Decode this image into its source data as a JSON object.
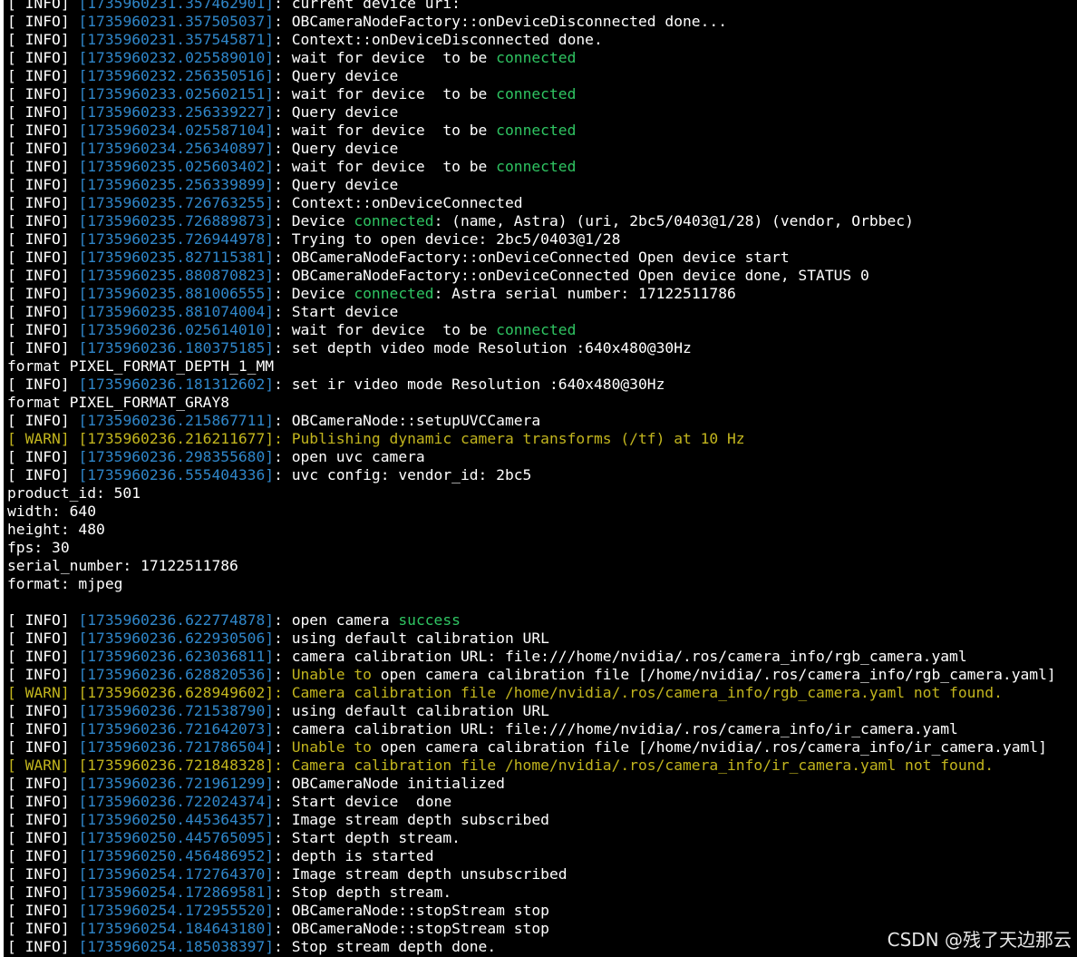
{
  "colors": {
    "background": "#000000",
    "text": "#ffffff",
    "timestamp": "#2f86c9",
    "warn": "#c2b51e",
    "highlight_green": "#2fc462"
  },
  "watermark": "CSDN @残了天边那云",
  "lines": [
    {
      "level": "INFO",
      "ts": "1735960231.357462901",
      "parts": [
        {
          "t": "current device uri:"
        }
      ]
    },
    {
      "level": "INFO",
      "ts": "1735960231.357505037",
      "parts": [
        {
          "t": "OBCameraNodeFactory::onDeviceDisconnected done..."
        }
      ]
    },
    {
      "level": "INFO",
      "ts": "1735960231.357545871",
      "parts": [
        {
          "t": "Context::onDeviceDisconnected done."
        }
      ]
    },
    {
      "level": "INFO",
      "ts": "1735960232.025589010",
      "parts": [
        {
          "t": "wait for device  to be "
        },
        {
          "t": "connected",
          "c": "green"
        }
      ]
    },
    {
      "level": "INFO",
      "ts": "1735960232.256350516",
      "parts": [
        {
          "t": "Query device"
        }
      ]
    },
    {
      "level": "INFO",
      "ts": "1735960233.025602151",
      "parts": [
        {
          "t": "wait for device  to be "
        },
        {
          "t": "connected",
          "c": "green"
        }
      ]
    },
    {
      "level": "INFO",
      "ts": "1735960233.256339227",
      "parts": [
        {
          "t": "Query device"
        }
      ]
    },
    {
      "level": "INFO",
      "ts": "1735960234.025587104",
      "parts": [
        {
          "t": "wait for device  to be "
        },
        {
          "t": "connected",
          "c": "green"
        }
      ]
    },
    {
      "level": "INFO",
      "ts": "1735960234.256340897",
      "parts": [
        {
          "t": "Query device"
        }
      ]
    },
    {
      "level": "INFO",
      "ts": "1735960235.025603402",
      "parts": [
        {
          "t": "wait for device  to be "
        },
        {
          "t": "connected",
          "c": "green"
        }
      ]
    },
    {
      "level": "INFO",
      "ts": "1735960235.256339899",
      "parts": [
        {
          "t": "Query device"
        }
      ]
    },
    {
      "level": "INFO",
      "ts": "1735960235.726763255",
      "parts": [
        {
          "t": "Context::onDeviceConnected"
        }
      ]
    },
    {
      "level": "INFO",
      "ts": "1735960235.726889873",
      "parts": [
        {
          "t": "Device "
        },
        {
          "t": "connected",
          "c": "green"
        },
        {
          "t": ": (name, Astra) (uri, 2bc5/0403@1/28) (vendor, Orbbec)"
        }
      ]
    },
    {
      "level": "INFO",
      "ts": "1735960235.726944978",
      "parts": [
        {
          "t": "Trying to open device: 2bc5/0403@1/28"
        }
      ]
    },
    {
      "level": "INFO",
      "ts": "1735960235.827115381",
      "parts": [
        {
          "t": "OBCameraNodeFactory::onDeviceConnected Open device start"
        }
      ]
    },
    {
      "level": "INFO",
      "ts": "1735960235.880870823",
      "parts": [
        {
          "t": "OBCameraNodeFactory::onDeviceConnected Open device done, STATUS 0"
        }
      ]
    },
    {
      "level": "INFO",
      "ts": "1735960235.881006555",
      "parts": [
        {
          "t": "Device "
        },
        {
          "t": "connected",
          "c": "green"
        },
        {
          "t": ": Astra serial number: 17122511786"
        }
      ]
    },
    {
      "level": "INFO",
      "ts": "1735960235.881074004",
      "parts": [
        {
          "t": "Start device"
        }
      ]
    },
    {
      "level": "INFO",
      "ts": "1735960236.025614010",
      "parts": [
        {
          "t": "wait for device  to be "
        },
        {
          "t": "connected",
          "c": "green"
        }
      ]
    },
    {
      "level": "INFO",
      "ts": "1735960236.180375185",
      "parts": [
        {
          "t": "set depth video mode Resolution :640x480@30Hz"
        }
      ]
    },
    {
      "plain": "format PIXEL_FORMAT_DEPTH_1_MM"
    },
    {
      "level": "INFO",
      "ts": "1735960236.181312602",
      "parts": [
        {
          "t": "set ir video mode Resolution :640x480@30Hz"
        }
      ]
    },
    {
      "plain": "format PIXEL_FORMAT_GRAY8"
    },
    {
      "level": "INFO",
      "ts": "1735960236.215867711",
      "parts": [
        {
          "t": "OBCameraNode::setupUVCCamera"
        }
      ]
    },
    {
      "level": "WARN",
      "ts": "1735960236.216211677",
      "parts": [
        {
          "t": "Publishing dynamic camera transforms (/tf) at 10 Hz",
          "c": "yellow"
        }
      ]
    },
    {
      "level": "INFO",
      "ts": "1735960236.298355680",
      "parts": [
        {
          "t": "open uvc camera"
        }
      ]
    },
    {
      "level": "INFO",
      "ts": "1735960236.555404336",
      "parts": [
        {
          "t": "uvc config: vendor_id: 2bc5"
        }
      ]
    },
    {
      "plain": "product_id: 501"
    },
    {
      "plain": "width: 640"
    },
    {
      "plain": "height: 480"
    },
    {
      "plain": "fps: 30"
    },
    {
      "plain": "serial_number: 17122511786"
    },
    {
      "plain": "format: mjpeg"
    },
    {
      "plain": ""
    },
    {
      "level": "INFO",
      "ts": "1735960236.622774878",
      "parts": [
        {
          "t": "open camera "
        },
        {
          "t": "success",
          "c": "green"
        }
      ]
    },
    {
      "level": "INFO",
      "ts": "1735960236.622930506",
      "parts": [
        {
          "t": "using default calibration URL"
        }
      ]
    },
    {
      "level": "INFO",
      "ts": "1735960236.623036811",
      "parts": [
        {
          "t": "camera calibration URL: file:///home/nvidia/.ros/camera_info/rgb_camera.yaml"
        }
      ]
    },
    {
      "level": "INFO",
      "ts": "1735960236.628820536",
      "parts": [
        {
          "t": "Unable to",
          "c": "yellow"
        },
        {
          "t": " open camera calibration file [/home/nvidia/.ros/camera_info/rgb_camera.yaml]"
        }
      ]
    },
    {
      "level": "WARN",
      "ts": "1735960236.628949602",
      "parts": [
        {
          "t": "Camera calibration file /home/nvidia/.ros/camera_info/rgb_camera.yaml not found.",
          "c": "yellow"
        }
      ]
    },
    {
      "level": "INFO",
      "ts": "1735960236.721538790",
      "parts": [
        {
          "t": "using default calibration URL"
        }
      ]
    },
    {
      "level": "INFO",
      "ts": "1735960236.721642073",
      "parts": [
        {
          "t": "camera calibration URL: file:///home/nvidia/.ros/camera_info/ir_camera.yaml"
        }
      ]
    },
    {
      "level": "INFO",
      "ts": "1735960236.721786504",
      "parts": [
        {
          "t": "Unable to",
          "c": "yellow"
        },
        {
          "t": " open camera calibration file [/home/nvidia/.ros/camera_info/ir_camera.yaml]"
        }
      ]
    },
    {
      "level": "WARN",
      "ts": "1735960236.721848328",
      "parts": [
        {
          "t": "Camera calibration file /home/nvidia/.ros/camera_info/ir_camera.yaml not found.",
          "c": "yellow"
        }
      ]
    },
    {
      "level": "INFO",
      "ts": "1735960236.721961299",
      "parts": [
        {
          "t": "OBCameraNode initialized"
        }
      ]
    },
    {
      "level": "INFO",
      "ts": "1735960236.722024374",
      "parts": [
        {
          "t": "Start device  done"
        }
      ]
    },
    {
      "level": "INFO",
      "ts": "1735960250.445364357",
      "parts": [
        {
          "t": "Image stream depth subscribed"
        }
      ]
    },
    {
      "level": "INFO",
      "ts": "1735960250.445765095",
      "parts": [
        {
          "t": "Start depth stream."
        }
      ]
    },
    {
      "level": "INFO",
      "ts": "1735960250.456486952",
      "parts": [
        {
          "t": "depth is started"
        }
      ]
    },
    {
      "level": "INFO",
      "ts": "1735960254.172764370",
      "parts": [
        {
          "t": "Image stream depth unsubscribed"
        }
      ]
    },
    {
      "level": "INFO",
      "ts": "1735960254.172869581",
      "parts": [
        {
          "t": "Stop depth stream."
        }
      ]
    },
    {
      "level": "INFO",
      "ts": "1735960254.172955520",
      "parts": [
        {
          "t": "OBCameraNode::stopStream stop"
        }
      ]
    },
    {
      "level": "INFO",
      "ts": "1735960254.184643180",
      "parts": [
        {
          "t": "OBCameraNode::stopStream stop"
        }
      ]
    },
    {
      "level": "INFO",
      "ts": "1735960254.185038397",
      "parts": [
        {
          "t": "Stop stream depth done."
        }
      ]
    }
  ]
}
